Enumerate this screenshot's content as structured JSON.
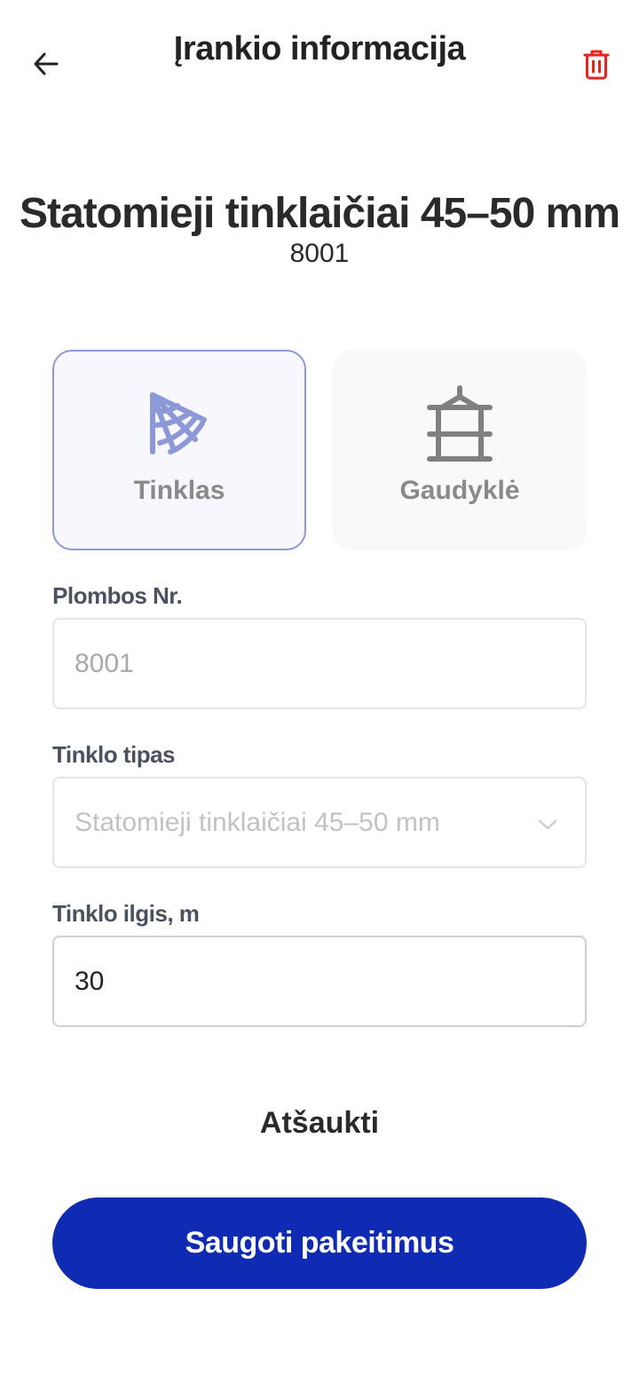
{
  "header": {
    "title": "Įrankio informacija",
    "back_icon": "arrow-left-icon",
    "delete_icon": "trash-icon",
    "delete_color": "#e8231c"
  },
  "tool": {
    "name": "Statomieji tinklaičiai 45–50 mm",
    "code": "8001"
  },
  "tool_types": [
    {
      "label": "Tinklas",
      "icon": "net-icon",
      "selected": true,
      "icon_color": "#8d99d6"
    },
    {
      "label": "Gaudyklė",
      "icon": "trap-icon",
      "selected": false,
      "icon_color": "#808080"
    }
  ],
  "form": {
    "seal_number": {
      "label": "Plombos Nr.",
      "value": "8001",
      "disabled": true
    },
    "net_type": {
      "label": "Tinklo tipas",
      "value": "Statomieji tinklaičiai 45–50 mm",
      "disabled": true
    },
    "net_length": {
      "label": "Tinklo ilgis, m",
      "value": "30"
    }
  },
  "actions": {
    "cancel_label": "Atšaukti",
    "save_label": "Saugoti pakeitimus",
    "save_color": "#0f2bb4"
  }
}
